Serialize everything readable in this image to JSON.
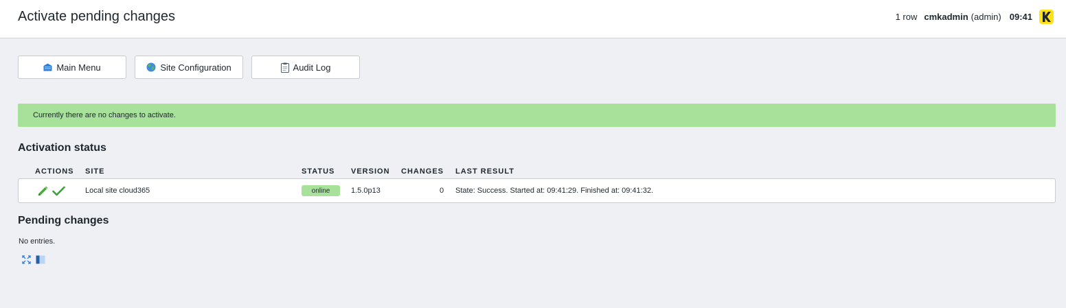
{
  "header": {
    "title": "Activate pending changes",
    "row_count": "1 row",
    "user_name": "cmkadmin",
    "user_role": "(admin)",
    "clock": "09:41",
    "logo_icon": "checkmk-logo"
  },
  "buttons": {
    "main_menu": {
      "label": "Main Menu",
      "icon": "home-icon"
    },
    "site_config": {
      "label": "Site Configuration",
      "icon": "globe-icon"
    },
    "audit_log": {
      "label": "Audit Log",
      "icon": "clipboard-icon"
    }
  },
  "notice": {
    "text": "Currently there are no changes to activate.",
    "color": "#a7e19a"
  },
  "activation_status": {
    "title": "Activation status",
    "columns": [
      "ACTIONS",
      "SITE",
      "STATUS",
      "VERSION",
      "CHANGES",
      "LAST RESULT"
    ],
    "rows": [
      {
        "actions": [
          "edit-icon",
          "checkmark-icon"
        ],
        "site": "Local site cloud365",
        "status": "online",
        "version": "1.5.0p13",
        "changes": "0",
        "last_result": "State: Success. Started at: 09:41:29. Finished at: 09:41:32."
      }
    ]
  },
  "pending_changes": {
    "title": "Pending changes",
    "empty_text": "No entries.",
    "footer_icons": [
      "expand-icon",
      "sidebar-toggle-icon"
    ]
  },
  "colors": {
    "accent_green": "#a7e19a",
    "logo_yellow": "#ffe21a",
    "background": "#eff0f4"
  }
}
